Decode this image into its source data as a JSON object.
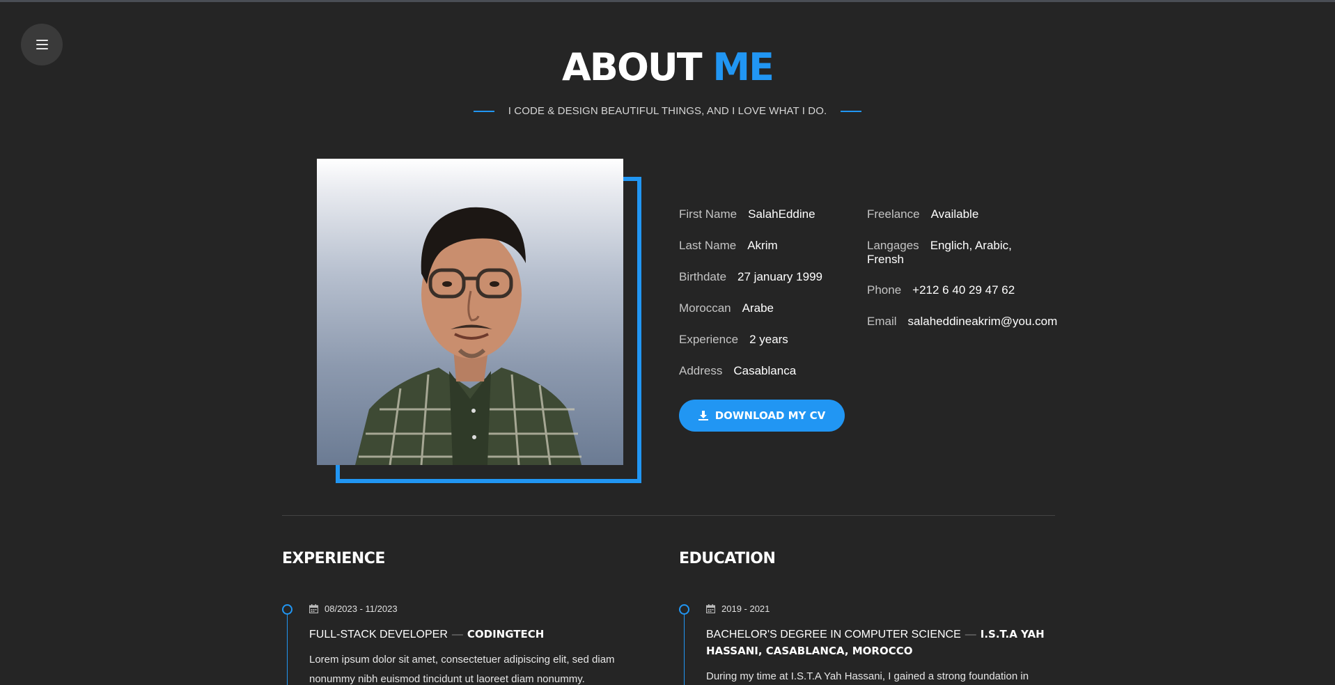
{
  "header": {
    "title_main": "ABOUT",
    "title_accent": "ME",
    "subtitle": "I CODE & DESIGN BEAUTIFUL THINGS, AND I LOVE WHAT I DO."
  },
  "menu": {
    "icon": "hamburger-icon"
  },
  "profile": {
    "photo_alt": "Portrait photo",
    "left_fields": [
      {
        "label": "First Name",
        "value": "SalahEddine"
      },
      {
        "label": "Last Name",
        "value": "Akrim"
      },
      {
        "label": "Birthdate",
        "value": "27 january 1999"
      },
      {
        "label": "Moroccan",
        "value": "Arabe"
      },
      {
        "label": "Experience",
        "value": "2 years"
      },
      {
        "label": "Address",
        "value": "Casablanca"
      }
    ],
    "right_fields": [
      {
        "label": "Freelance",
        "value": "Available"
      },
      {
        "label": "Langages",
        "value": "Englich, Arabic, Frensh"
      },
      {
        "label": "Phone",
        "value": "+212 6 40 29 47 62"
      },
      {
        "label": "Email",
        "value": "salaheddineakrim@you.com"
      }
    ],
    "cv_button": {
      "label": "DOWNLOAD MY CV",
      "icon": "download-icon"
    }
  },
  "experience": {
    "title": "EXPERIENCE",
    "items": [
      {
        "date": "08/2023 - 11/2023",
        "role": "FULL-STACK DEVELOPER",
        "org": "CODINGTECH",
        "desc_line1": "Lorem ipsum dolor sit amet, consectetuer adipiscing elit, sed diam",
        "desc_line2": "nonummy nibh euismod tincidunt ut laoreet diam nonummy."
      }
    ]
  },
  "education": {
    "title": "EDUCATION",
    "items": [
      {
        "date": "2019 - 2021",
        "role": "BACHELOR'S DEGREE IN COMPUTER SCIENCE",
        "org_line1": "I.S.T.A YAH",
        "org_line2": "HASSANI, CASABLANCA, MOROCCO",
        "desc_line1": "During my time at I.S.T.A Yah Hassani, I gained a strong foundation in"
      }
    ]
  },
  "colors": {
    "accent": "#2196f3",
    "background": "#252525"
  }
}
